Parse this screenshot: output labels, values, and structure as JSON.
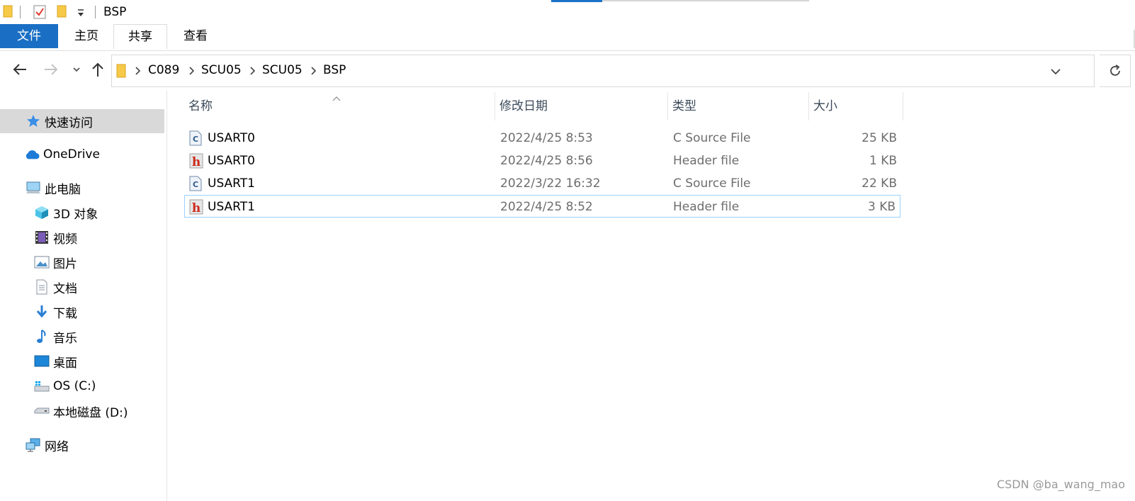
{
  "window": {
    "title": "BSP"
  },
  "ribbon": {
    "tabs": [
      {
        "label": "文件"
      },
      {
        "label": "主页"
      },
      {
        "label": "共享"
      },
      {
        "label": "查看"
      }
    ]
  },
  "address": {
    "crumbs": [
      "C089",
      "SCU05",
      "SCU05",
      "BSP"
    ]
  },
  "sidebar": {
    "items": [
      {
        "label": "快速访问",
        "icon": "star-icon"
      },
      {
        "label": "OneDrive",
        "icon": "cloud-icon"
      },
      {
        "label": "此电脑",
        "icon": "computer-icon"
      },
      {
        "label": "3D 对象",
        "icon": "cube-icon"
      },
      {
        "label": "视频",
        "icon": "film-icon"
      },
      {
        "label": "图片",
        "icon": "picture-icon"
      },
      {
        "label": "文档",
        "icon": "document-icon"
      },
      {
        "label": "下载",
        "icon": "download-icon"
      },
      {
        "label": "音乐",
        "icon": "music-icon"
      },
      {
        "label": "桌面",
        "icon": "desktop-icon"
      },
      {
        "label": "OS (C:)",
        "icon": "drive-c-icon"
      },
      {
        "label": "本地磁盘 (D:)",
        "icon": "drive-d-icon"
      },
      {
        "label": "网络",
        "icon": "network-icon"
      }
    ]
  },
  "filelist": {
    "columns": [
      "名称",
      "修改日期",
      "类型",
      "大小"
    ],
    "rows": [
      {
        "name": "USART0",
        "date": "2022/4/25 8:53",
        "type": "C Source File",
        "size": "25 KB",
        "icon": "c-file-icon"
      },
      {
        "name": "USART0",
        "date": "2022/4/25 8:56",
        "type": "Header file",
        "size": "1 KB",
        "icon": "h-file-icon"
      },
      {
        "name": "USART1",
        "date": "2022/3/22 16:32",
        "type": "C Source File",
        "size": "22 KB",
        "icon": "c-file-icon"
      },
      {
        "name": "USART1",
        "date": "2022/4/25 8:52",
        "type": "Header file",
        "size": "3 KB",
        "icon": "h-file-icon"
      }
    ]
  },
  "watermark": "CSDN @ba_wang_mao",
  "colors": {
    "accent": "#1a6fc4",
    "selection_border": "#99d1ff",
    "folder": "#f7c948"
  }
}
